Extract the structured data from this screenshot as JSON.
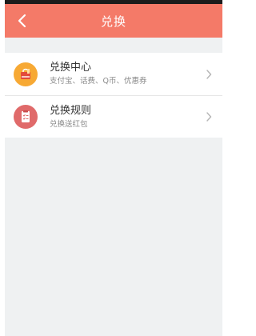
{
  "header": {
    "title": "兑换",
    "back_icon": "chevron-left-icon",
    "background": "#f47a68"
  },
  "list": {
    "items": [
      {
        "icon": "shopping-bag-icon",
        "icon_bg": "#f7a934",
        "title": "兑换中心",
        "subtitle": "支付宝、话费、Q币、优惠券"
      },
      {
        "icon": "document-checklist-icon",
        "icon_bg": "#e06a6a",
        "title": "兑换规则",
        "subtitle": "兑换送红包"
      }
    ]
  }
}
